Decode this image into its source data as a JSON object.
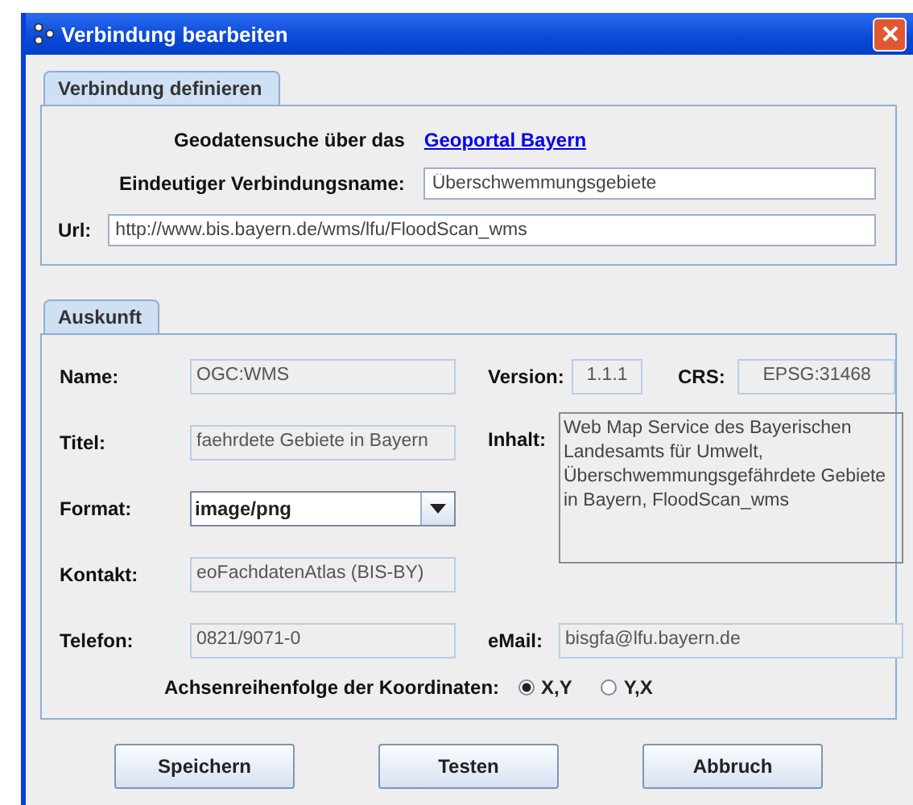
{
  "window": {
    "title": "Verbindung bearbeiten"
  },
  "connection": {
    "tab": "Verbindung definieren",
    "search_label": "Geodatensuche über das",
    "search_link": "Geoportal Bayern",
    "name_label": "Eindeutiger Verbindungsname:",
    "name_value": "Überschwemmungsgebiete",
    "url_label": "Url:",
    "url_value": "http://www.bis.bayern.de/wms/lfu/FloodScan_wms"
  },
  "info": {
    "tab": "Auskunft",
    "name_label": "Name:",
    "name_value": "OGC:WMS",
    "version_label": "Version:",
    "version_value": "1.1.1",
    "crs_label": "CRS:",
    "crs_value": "EPSG:31468",
    "title_label": "Titel:",
    "title_value": "faehrdete Gebiete in Bayern",
    "content_label": "Inhalt:",
    "content_value": "Web Map Service des Bayerischen Landesamts für Umwelt, Überschwemmungsgefährdete Gebiete in Bayern, FloodScan_wms",
    "format_label": "Format:",
    "format_value": "image/png",
    "contact_label": "Kontakt:",
    "contact_value": "eoFachdatenAtlas (BIS-BY)",
    "phone_label": "Telefon:",
    "phone_value": "0821/9071-0",
    "email_label": "eMail:",
    "email_value": "bisgfa@lfu.bayern.de",
    "axis_label": "Achsenreihenfolge der Koordinaten:",
    "axis_options": [
      {
        "label": "X,Y",
        "selected": true
      },
      {
        "label": "Y,X",
        "selected": false
      }
    ]
  },
  "buttons": [
    "Speichern",
    "Testen",
    "Abbruch"
  ]
}
